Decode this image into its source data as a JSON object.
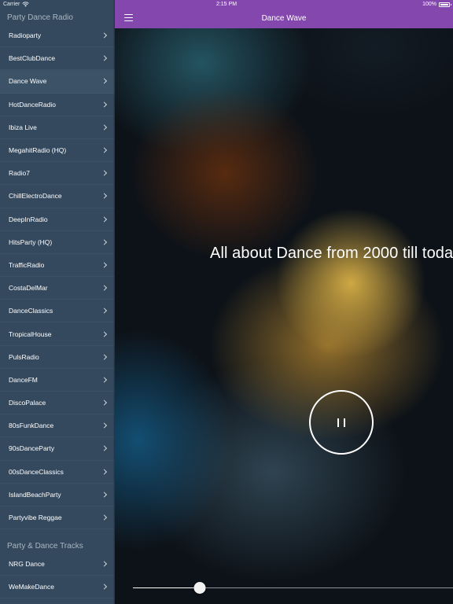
{
  "status_bar": {
    "carrier": "Carrier",
    "time": "2:15 PM",
    "battery": "100%"
  },
  "sidebar": {
    "sections": [
      {
        "title": "Party Dance Radio",
        "items": [
          {
            "label": "Radioparty"
          },
          {
            "label": "BestClubDance"
          },
          {
            "label": "Dance Wave",
            "selected": true
          },
          {
            "label": "HotDanceRadio"
          },
          {
            "label": "Ibiza Live"
          },
          {
            "label": "MegahitRadio (HQ)"
          },
          {
            "label": "Radio7"
          },
          {
            "label": "ChillElectroDance"
          },
          {
            "label": "DeepInRadio"
          },
          {
            "label": "HitsParty (HQ)"
          },
          {
            "label": "TrafficRadio"
          },
          {
            "label": "CostaDelMar"
          },
          {
            "label": "DanceClassics"
          },
          {
            "label": "TropicalHouse"
          },
          {
            "label": "PulsRadio"
          },
          {
            "label": "DanceFM"
          },
          {
            "label": "DiscoPalace"
          },
          {
            "label": "80sFunkDance"
          },
          {
            "label": "90sDanceParty"
          },
          {
            "label": "00sDanceClassics"
          },
          {
            "label": "IslandBeachParty"
          },
          {
            "label": "Partyvibe Reggae"
          }
        ]
      },
      {
        "title": "Party & Dance Tracks",
        "items": [
          {
            "label": "NRG Dance"
          },
          {
            "label": "WeMakeDance"
          }
        ]
      }
    ]
  },
  "navbar": {
    "title": "Dance Wave",
    "menu_icon": "hamburger-icon",
    "color": "#8347ad"
  },
  "player": {
    "tagline": "All about Dance from 2000 till toda",
    "state": "playing",
    "control_icon": "pause-icon",
    "volume_fraction": 0.21
  },
  "colors": {
    "sidebar_bg": "#34495e",
    "sidebar_selected": "#3b5267",
    "accent": "#8347ad"
  }
}
